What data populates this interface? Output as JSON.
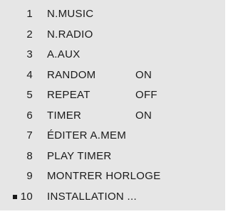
{
  "menu": {
    "selected_index": 9,
    "items": [
      {
        "number": "1",
        "label": "N.MUSIC",
        "status": ""
      },
      {
        "number": "2",
        "label": "N.RADIO",
        "status": ""
      },
      {
        "number": "3",
        "label": "A.AUX",
        "status": ""
      },
      {
        "number": "4",
        "label": "RANDOM",
        "status": "ON"
      },
      {
        "number": "5",
        "label": "REPEAT",
        "status": "OFF"
      },
      {
        "number": "6",
        "label": "TIMER",
        "status": "ON"
      },
      {
        "number": "7",
        "label": "ÉDITER A.MEM",
        "status": ""
      },
      {
        "number": "8",
        "label": "PLAY TIMER",
        "status": ""
      },
      {
        "number": "9",
        "label": "MONTRER HORLOGE",
        "status": ""
      },
      {
        "number": "10",
        "label": "INSTALLATION ...",
        "status": ""
      }
    ]
  }
}
